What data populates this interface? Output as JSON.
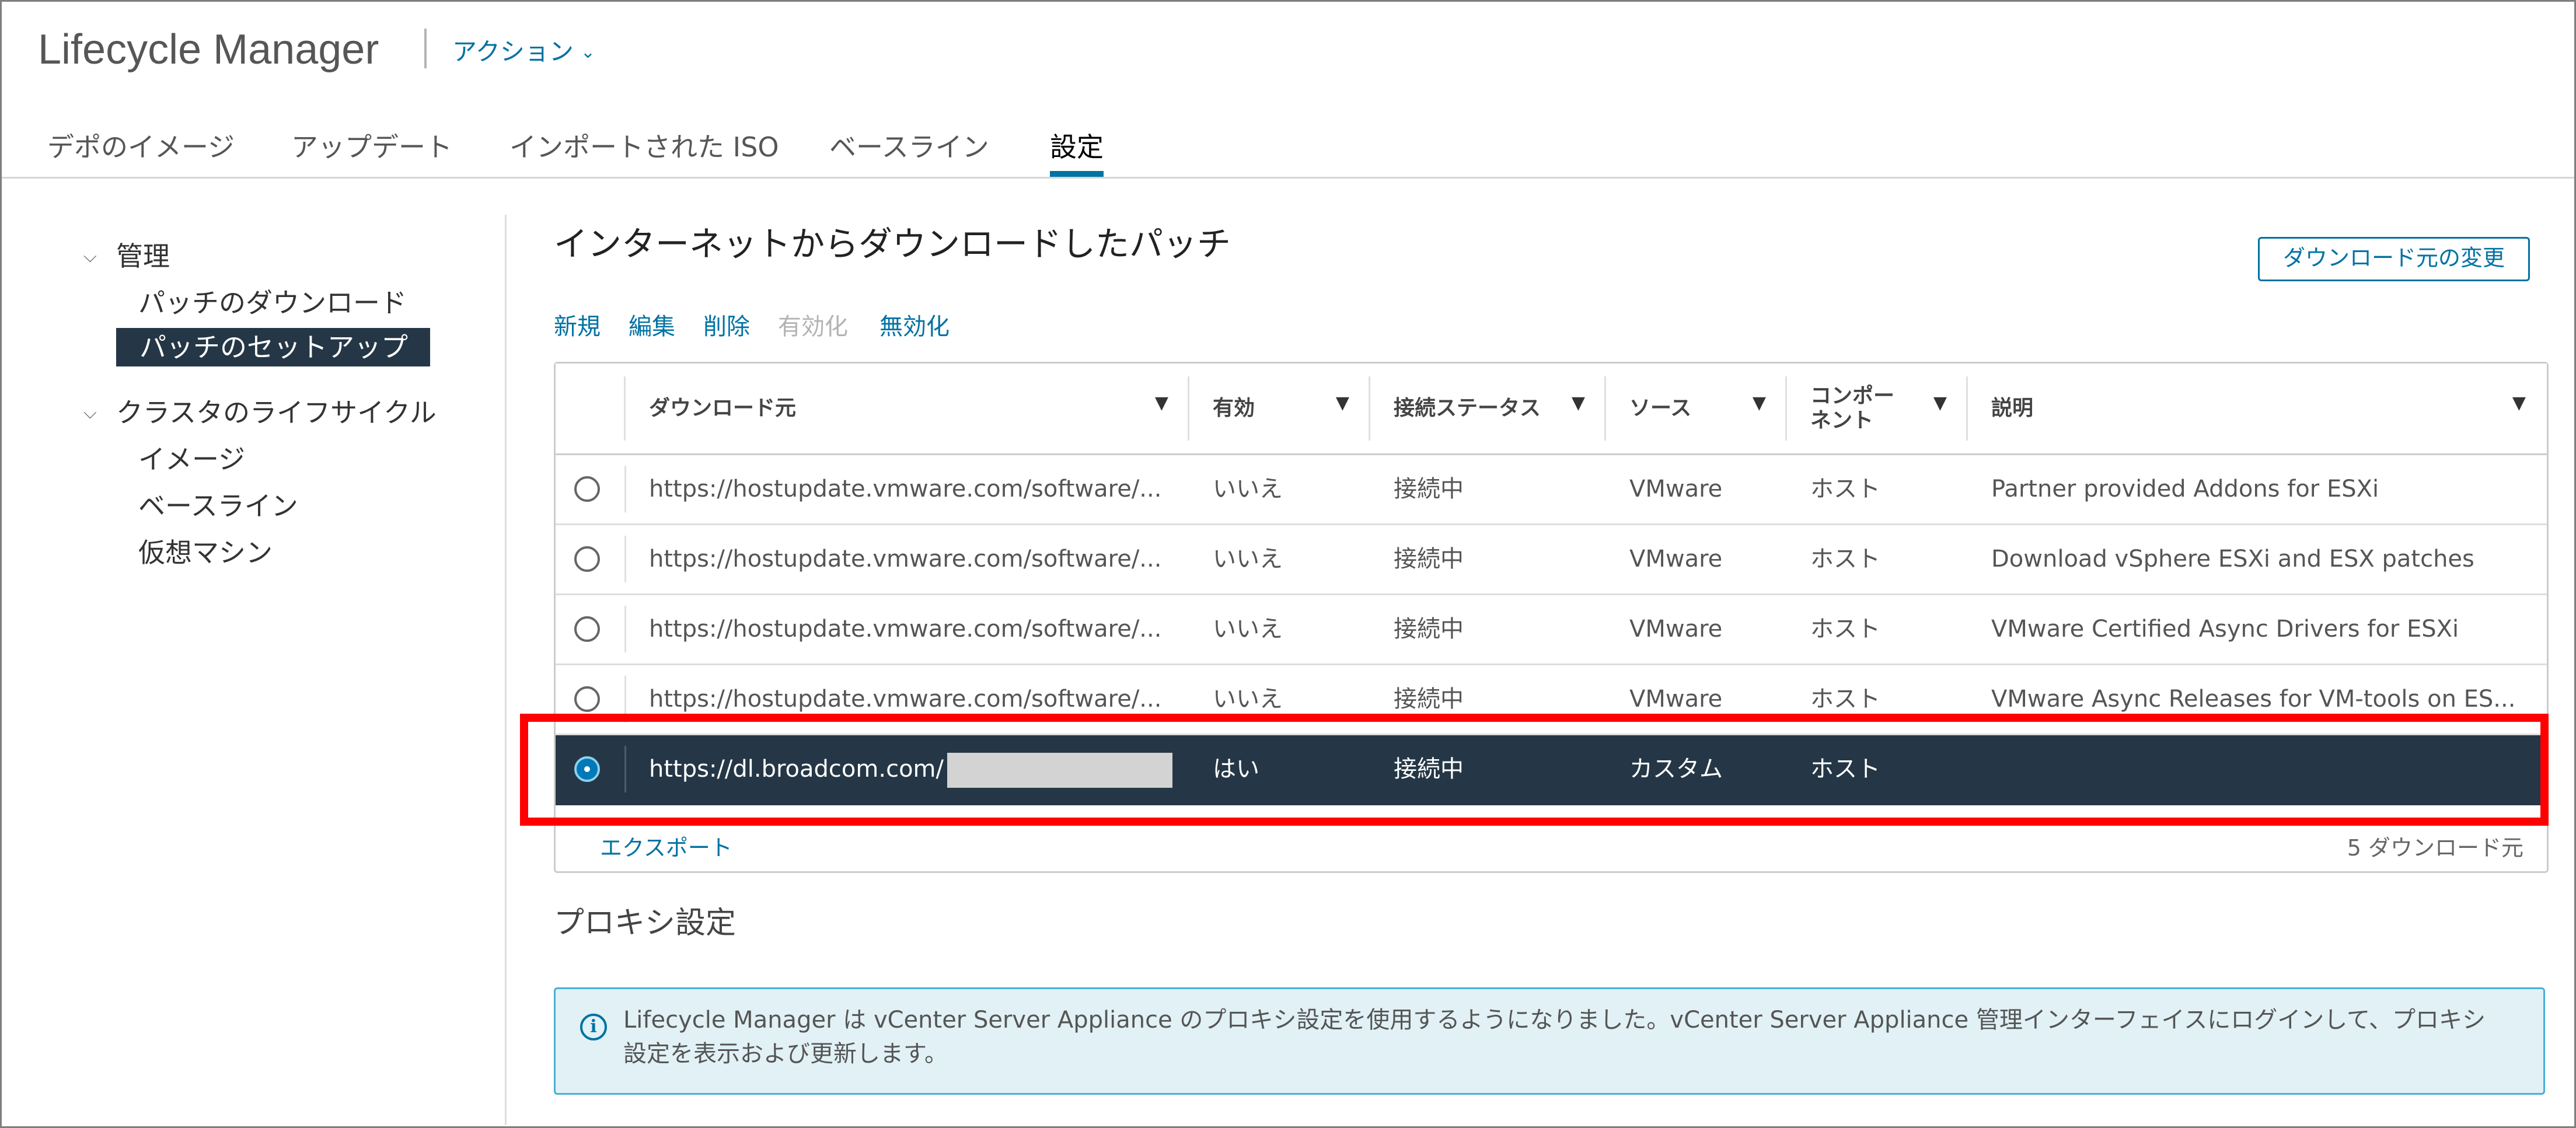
{
  "header": {
    "app_title": "Lifecycle Manager",
    "actions_label": "アクション"
  },
  "tabs": [
    {
      "label": "デポのイメージ"
    },
    {
      "label": "アップデート"
    },
    {
      "label": "インポートされた ISO"
    },
    {
      "label": "ベースライン"
    },
    {
      "label": "設定",
      "active": true
    }
  ],
  "sidebar": {
    "groups": [
      {
        "label": "管理",
        "items": [
          {
            "label": "パッチのダウンロード"
          },
          {
            "label": "パッチのセットアップ",
            "selected": true
          }
        ]
      },
      {
        "label": "クラスタのライフサイクル",
        "items": [
          {
            "label": "イメージ"
          },
          {
            "label": "ベースライン"
          },
          {
            "label": "仮想マシン"
          }
        ]
      }
    ]
  },
  "main": {
    "title": "インターネットからダウンロードしたパッチ",
    "change_source_button": "ダウンロード元の変更",
    "toolbar": [
      {
        "label": "新規",
        "enabled": true
      },
      {
        "label": "編集",
        "enabled": true
      },
      {
        "label": "削除",
        "enabled": true
      },
      {
        "label": "有効化",
        "enabled": false
      },
      {
        "label": "無効化",
        "enabled": true
      }
    ],
    "table": {
      "columns": [
        "ダウンロード元",
        "有効",
        "接続ステータス",
        "ソース",
        "コンポーネント",
        "説明"
      ],
      "column_display": [
        "ダウンロード元",
        "有効",
        "接続ステータス",
        "ソース",
        "コンポー\nネント",
        "説明"
      ],
      "rows": [
        {
          "source_url": "https://hostupdate.vmware.com/software/...",
          "enabled": "いいえ",
          "status": "接続中",
          "source": "VMware",
          "component": "ホスト",
          "description": "Partner provided Addons for ESXi",
          "selected": false
        },
        {
          "source_url": "https://hostupdate.vmware.com/software/...",
          "enabled": "いいえ",
          "status": "接続中",
          "source": "VMware",
          "component": "ホスト",
          "description": "Download vSphere ESXi and ESX patches",
          "selected": false
        },
        {
          "source_url": "https://hostupdate.vmware.com/software/...",
          "enabled": "いいえ",
          "status": "接続中",
          "source": "VMware",
          "component": "ホスト",
          "description": "VMware Certified Async Drivers for ESXi",
          "selected": false
        },
        {
          "source_url": "https://hostupdate.vmware.com/software/...",
          "enabled": "いいえ",
          "status": "接続中",
          "source": "VMware",
          "component": "ホスト",
          "description": "VMware Async Releases for VM-tools on ES...",
          "selected": false
        },
        {
          "source_url": "https://dl.broadcom.com/",
          "enabled": "はい",
          "status": "接続中",
          "source": "カスタム",
          "component": "ホスト",
          "description": "",
          "selected": true
        }
      ],
      "export_label": "エクスポート",
      "count_label": "5 ダウンロード元"
    },
    "proxy": {
      "title": "プロキシ設定",
      "info_text": "Lifecycle Manager は vCenter Server Appliance のプロキシ設定を使用するようになりました。vCenter Server Appliance 管理インターフェイスにログインして、プロキシ設定を表示および更新します。"
    }
  },
  "colors": {
    "accent": "#0072a3",
    "selected_bg": "#253746",
    "highlight": "#ff0000",
    "info_bg": "#e1f1f6"
  }
}
